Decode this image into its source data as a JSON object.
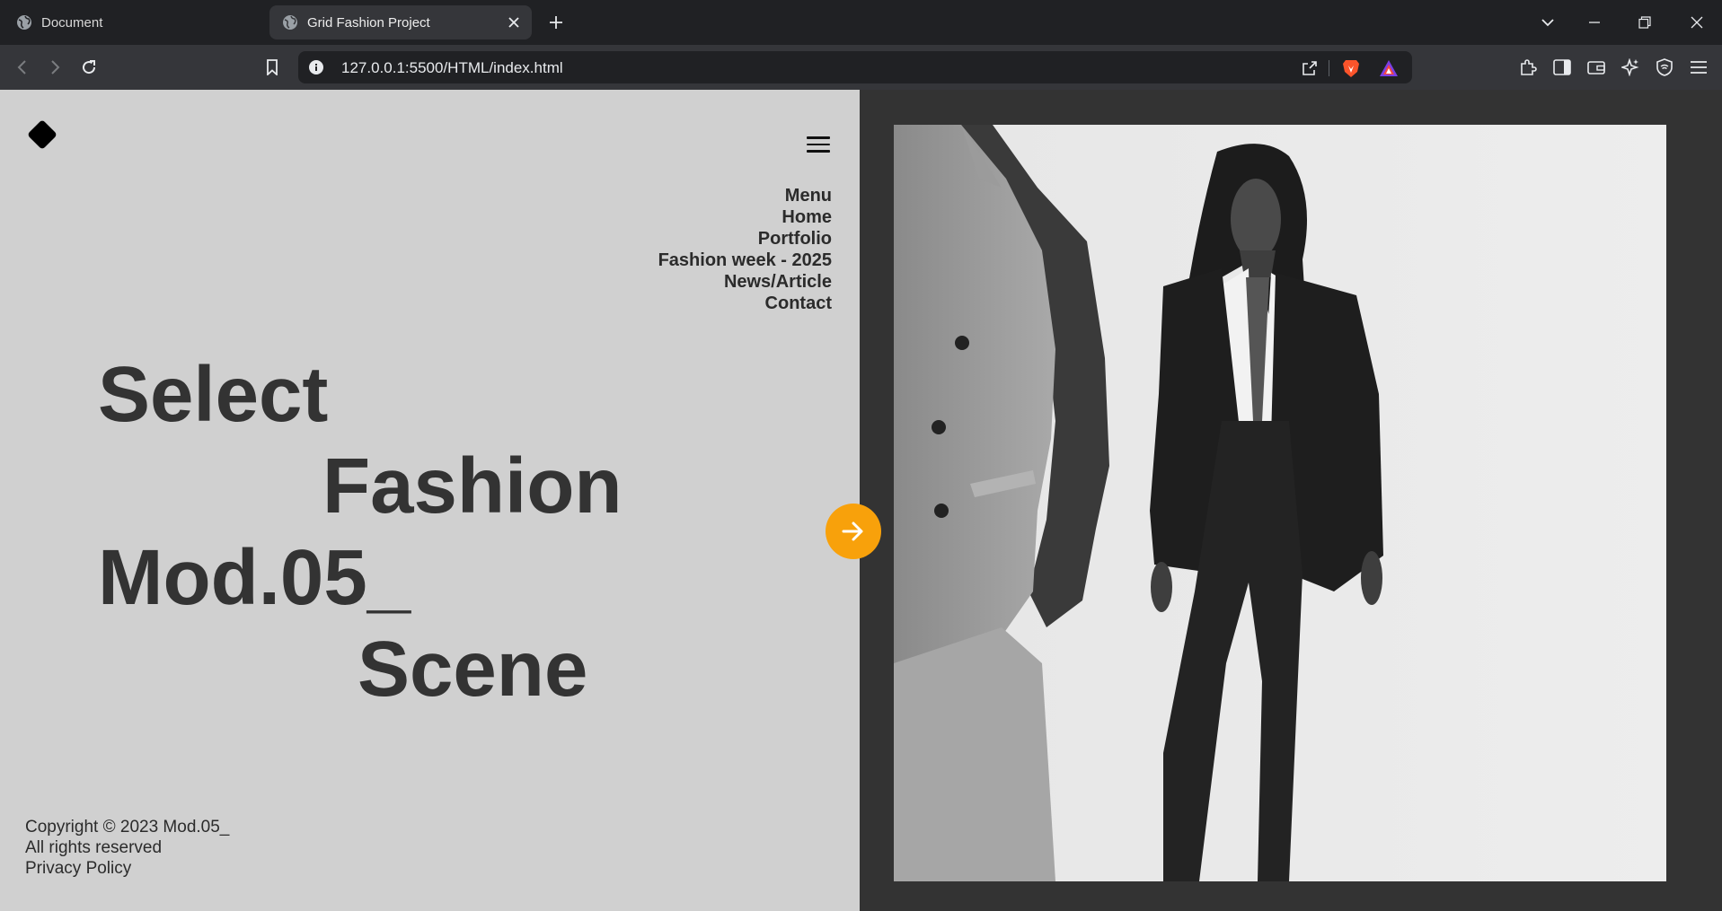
{
  "browser": {
    "tabs": [
      {
        "title": "Document",
        "active": false
      },
      {
        "title": "Grid Fashion Project",
        "active": true
      }
    ],
    "url": "127.0.0.1:5500/HTML/index.html"
  },
  "nav": {
    "items": [
      "Menu",
      "Home",
      "Portfolio",
      "Fashion week - 2025",
      "News/Article",
      "Contact"
    ]
  },
  "hero": {
    "line1": "Select",
    "line2": "Fashion",
    "line3": "Mod.05_",
    "line4": "Scene"
  },
  "footer": {
    "copyright": "Copyright © 2023 Mod.05_",
    "rights": "All rights reserved",
    "privacy": "Privacy Policy"
  },
  "colors": {
    "accent": "#f8a10b",
    "panel": "#d0d0d0",
    "background": "#333333"
  }
}
